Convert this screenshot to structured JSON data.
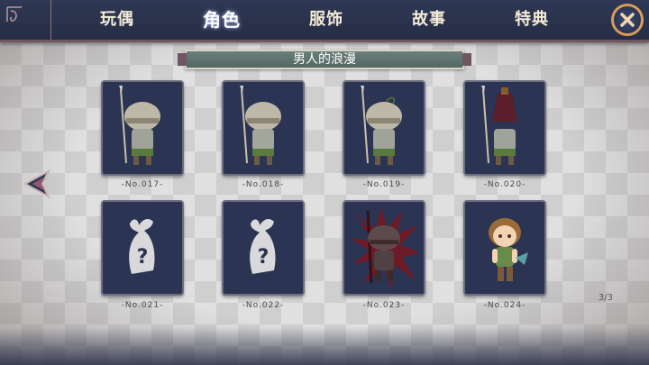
{
  "tabs": [
    {
      "label": "玩偶"
    },
    {
      "label": "角色"
    },
    {
      "label": "服饰"
    },
    {
      "label": "故事"
    },
    {
      "label": "特典"
    }
  ],
  "active_tab": "角色",
  "section_title": "男人的浪漫",
  "cards": [
    {
      "number": "-No.017-",
      "kind": "soldier"
    },
    {
      "number": "-No.018-",
      "kind": "soldier"
    },
    {
      "number": "-No.019-",
      "kind": "soldier"
    },
    {
      "number": "-No.020-",
      "kind": "soldier-hat"
    },
    {
      "number": "-No.021-",
      "kind": "locked"
    },
    {
      "number": "-No.022-",
      "kind": "locked"
    },
    {
      "number": "-No.023-",
      "kind": "soldier-cursed"
    },
    {
      "number": "-No.024-",
      "kind": "boy"
    }
  ],
  "page_indicator": "3/3",
  "icons": {
    "close": "close-icon",
    "back": "back-arrow-icon",
    "locked": "mystery-silhouette-icon"
  },
  "colors": {
    "nav_bg": "#2f3854",
    "card_bg": "#2b3452",
    "close_ring": "#d79b5c",
    "ribbon": "#6b7f7a"
  }
}
